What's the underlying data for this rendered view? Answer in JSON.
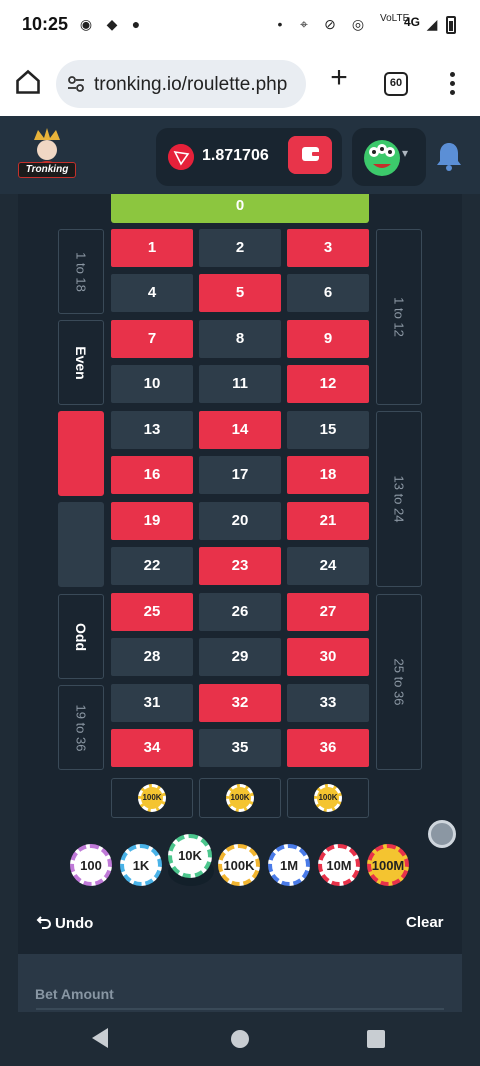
{
  "status_bar": {
    "time": "10:25",
    "network_label": "VoLTE",
    "network_type": "4G"
  },
  "browser": {
    "url": "tronking.io/roulette.php",
    "tab_count": "60"
  },
  "header": {
    "logo_text": "Tronking",
    "balance": "1.871706",
    "currency_icon": "tron-icon"
  },
  "board": {
    "zero": "0",
    "numbers": [
      {
        "n": "1",
        "color": "red"
      },
      {
        "n": "2",
        "color": "black"
      },
      {
        "n": "3",
        "color": "red"
      },
      {
        "n": "4",
        "color": "black"
      },
      {
        "n": "5",
        "color": "red"
      },
      {
        "n": "6",
        "color": "black"
      },
      {
        "n": "7",
        "color": "red"
      },
      {
        "n": "8",
        "color": "black"
      },
      {
        "n": "9",
        "color": "red"
      },
      {
        "n": "10",
        "color": "black"
      },
      {
        "n": "11",
        "color": "black"
      },
      {
        "n": "12",
        "color": "red"
      },
      {
        "n": "13",
        "color": "black"
      },
      {
        "n": "14",
        "color": "red"
      },
      {
        "n": "15",
        "color": "black"
      },
      {
        "n": "16",
        "color": "red"
      },
      {
        "n": "17",
        "color": "black"
      },
      {
        "n": "18",
        "color": "red"
      },
      {
        "n": "19",
        "color": "red"
      },
      {
        "n": "20",
        "color": "black"
      },
      {
        "n": "21",
        "color": "red"
      },
      {
        "n": "22",
        "color": "black"
      },
      {
        "n": "23",
        "color": "red"
      },
      {
        "n": "24",
        "color": "black"
      },
      {
        "n": "25",
        "color": "red"
      },
      {
        "n": "26",
        "color": "black"
      },
      {
        "n": "27",
        "color": "red"
      },
      {
        "n": "28",
        "color": "black"
      },
      {
        "n": "29",
        "color": "black"
      },
      {
        "n": "30",
        "color": "red"
      },
      {
        "n": "31",
        "color": "black"
      },
      {
        "n": "32",
        "color": "red"
      },
      {
        "n": "33",
        "color": "black"
      },
      {
        "n": "34",
        "color": "red"
      },
      {
        "n": "35",
        "color": "black"
      },
      {
        "n": "36",
        "color": "red"
      }
    ],
    "left_bets": {
      "low": "1 to 18",
      "even": "Even",
      "odd": "Odd",
      "high": "19 to 36"
    },
    "dozens": {
      "first": "1 to 12",
      "second": "13 to 24",
      "third": "25 to 36"
    },
    "column_chip_label": "100K"
  },
  "chips": [
    {
      "label": "100",
      "cls": "c100"
    },
    {
      "label": "1K",
      "cls": "c1k"
    },
    {
      "label": "10K",
      "cls": "c10k"
    },
    {
      "label": "100K",
      "cls": "c100k"
    },
    {
      "label": "1M",
      "cls": "c1m"
    },
    {
      "label": "10M",
      "cls": "c10m"
    },
    {
      "label": "100M",
      "cls": "c100m"
    }
  ],
  "actions": {
    "undo": "Undo",
    "clear": "Clear"
  },
  "bet": {
    "label": "Bet Amount"
  },
  "colors": {
    "red": "#e8324a",
    "black": "#2e3d4a",
    "green": "#8cc63f",
    "background": "#1f2b36"
  }
}
